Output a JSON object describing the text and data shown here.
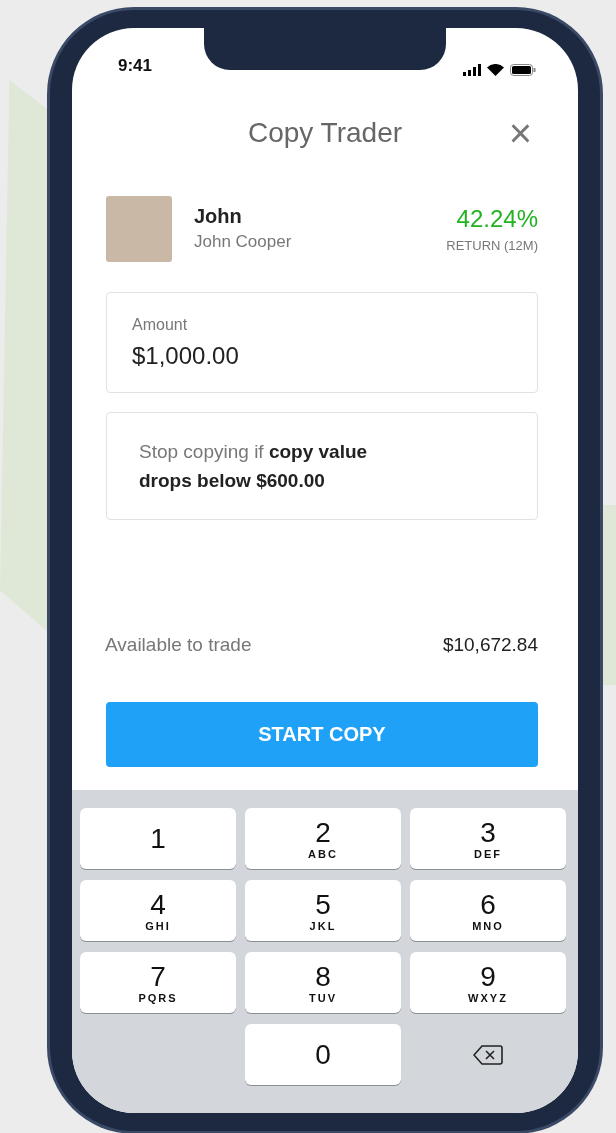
{
  "status_bar": {
    "time": "9:41"
  },
  "header": {
    "title": "Copy Trader",
    "close": "×"
  },
  "trader": {
    "nickname": "John",
    "full_name": "John Cooper",
    "return_value": "42.24%",
    "return_label": "RETURN (12M)"
  },
  "amount": {
    "label": "Amount",
    "value": "$1,000.00"
  },
  "stop_loss": {
    "text": "Stop copying if **copy value drops below $600.00**"
  },
  "available": {
    "label": "Available to trade",
    "value": "$10,672.84"
  },
  "button": {
    "label": "START COPY"
  },
  "keypad": [
    {
      "kind": "digit",
      "digit": "1"
    },
    {
      "kind": "digit",
      "digit": "2",
      "letters": "ABC"
    },
    {
      "kind": "digit",
      "digit": "3",
      "letters": "DEF"
    },
    {
      "kind": "digit",
      "digit": "4",
      "letters": "GHI"
    },
    {
      "kind": "digit",
      "digit": "5",
      "letters": "JKL"
    },
    {
      "kind": "digit",
      "digit": "6",
      "letters": "MNO"
    },
    {
      "kind": "digit",
      "digit": "7",
      "letters": "PQRS"
    },
    {
      "kind": "digit",
      "digit": "8",
      "letters": "TUV"
    },
    {
      "kind": "digit",
      "digit": "9",
      "letters": "WXYZ"
    },
    {
      "kind": "blank"
    },
    {
      "kind": "digit",
      "digit": "0"
    },
    {
      "kind": "delete"
    }
  ]
}
